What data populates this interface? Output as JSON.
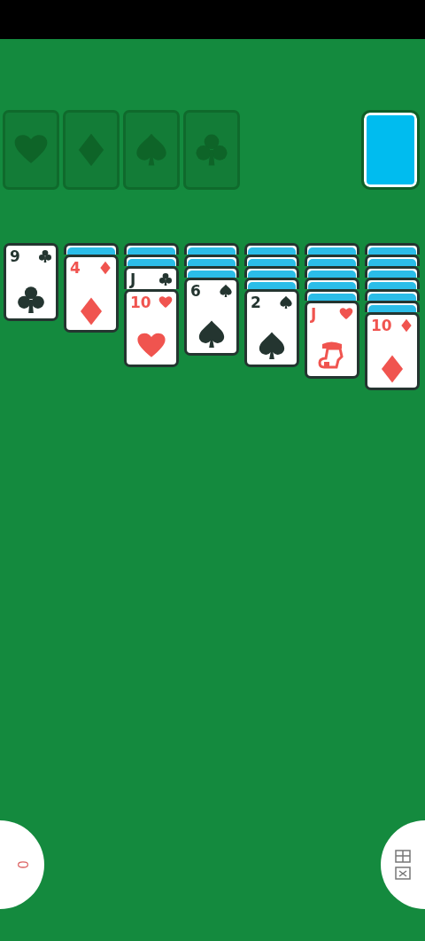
{
  "foundations": [
    {
      "kind": "hearts"
    },
    {
      "kind": "diamonds"
    },
    {
      "kind": "spades"
    },
    {
      "kind": "clubs"
    }
  ],
  "stock": {
    "kind": "card-back"
  },
  "tableau": [
    {
      "cards": [
        {
          "face_up": true,
          "rank": "9",
          "kind": "clubs"
        }
      ]
    },
    {
      "cards": [
        {
          "face_up": false
        },
        {
          "face_up": true,
          "rank": "4",
          "kind": "diamonds"
        }
      ]
    },
    {
      "cards": [
        {
          "face_up": false
        },
        {
          "face_up": false
        },
        {
          "face_up": true,
          "rank": "J",
          "kind": "clubs"
        },
        {
          "face_up": true,
          "rank": "10",
          "kind": "hearts"
        }
      ]
    },
    {
      "cards": [
        {
          "face_up": false
        },
        {
          "face_up": false
        },
        {
          "face_up": false
        },
        {
          "face_up": true,
          "rank": "6",
          "kind": "spades"
        }
      ]
    },
    {
      "cards": [
        {
          "face_up": false
        },
        {
          "face_up": false
        },
        {
          "face_up": false
        },
        {
          "face_up": false
        },
        {
          "face_up": true,
          "rank": "2",
          "kind": "spades"
        }
      ]
    },
    {
      "cards": [
        {
          "face_up": false
        },
        {
          "face_up": false
        },
        {
          "face_up": false
        },
        {
          "face_up": false
        },
        {
          "face_up": false
        },
        {
          "face_up": true,
          "rank": "J",
          "kind": "hearts"
        }
      ]
    },
    {
      "cards": [
        {
          "face_up": false
        },
        {
          "face_up": false
        },
        {
          "face_up": false
        },
        {
          "face_up": false
        },
        {
          "face_up": false
        },
        {
          "face_up": false
        },
        {
          "face_up": true,
          "rank": "10",
          "kind": "diamonds"
        }
      ]
    }
  ],
  "buttons": [
    {
      "kind": "label",
      "label": "0"
    },
    {
      "kind": "icon"
    }
  ]
}
